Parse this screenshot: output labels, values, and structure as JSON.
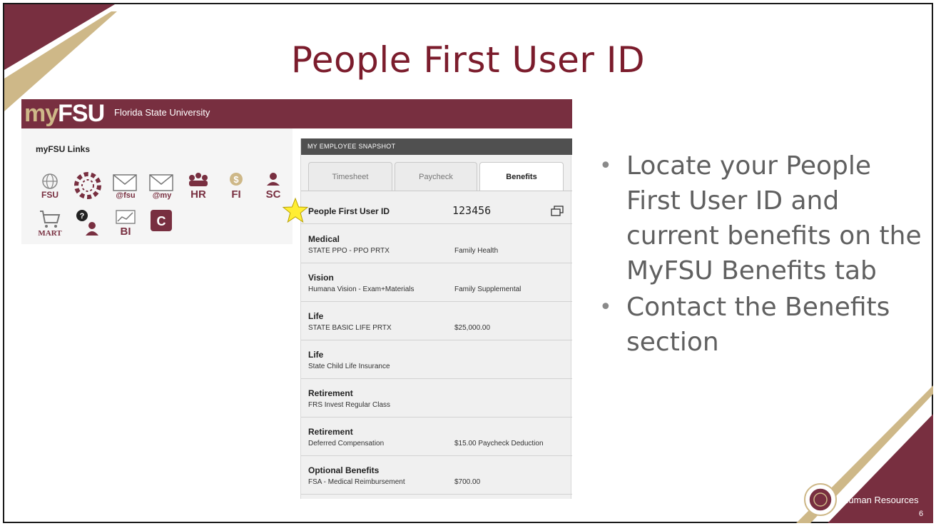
{
  "slide": {
    "title": "People First User ID",
    "page_number": "6",
    "footer_label": "Human Resources"
  },
  "colors": {
    "garnet": "#782f40",
    "gold": "#ceb888",
    "title": "#7b1c2c"
  },
  "myfsu": {
    "logo_my": "my",
    "logo_fsu": "FSU",
    "subtitle": "Florida State University",
    "links_title": "myFSU Links",
    "links": [
      {
        "icon": "globe-fsu-icon",
        "label": "FSU"
      },
      {
        "icon": "canvas-ring-icon",
        "label": ""
      },
      {
        "icon": "mail-fsu-icon",
        "label": "@fsu"
      },
      {
        "icon": "mail-my-icon",
        "label": "@my"
      },
      {
        "icon": "people-hr-icon",
        "label": "HR"
      },
      {
        "icon": "money-fi-icon",
        "label": "FI"
      },
      {
        "icon": "person-sc-icon",
        "label": "SC"
      },
      {
        "icon": "cart-mart-icon",
        "label": "MART"
      },
      {
        "icon": "help-person-icon",
        "label": ""
      },
      {
        "icon": "chart-bi-icon",
        "label": "BI"
      },
      {
        "icon": "c-logo-icon",
        "label": "C"
      }
    ]
  },
  "snapshot": {
    "header": "MY EMPLOYEE SNAPSHOT",
    "tabs": [
      "Timesheet",
      "Paycheck",
      "Benefits"
    ],
    "active_tab": "Benefits",
    "user_id_label": "People First User ID",
    "user_id_value": "123456",
    "benefits": [
      {
        "title": "Medical",
        "plan": "STATE PPO - PPO PRTX",
        "coverage": "Family Health"
      },
      {
        "title": "Vision",
        "plan": "Humana Vision - Exam+Materials",
        "coverage": "Family Supplemental"
      },
      {
        "title": "Life",
        "plan": "STATE BASIC LIFE PRTX",
        "coverage": "$25,000.00"
      },
      {
        "title": "Life",
        "plan": "State Child Life Insurance",
        "coverage": ""
      },
      {
        "title": "Retirement",
        "plan": "FRS Invest Regular Class",
        "coverage": ""
      },
      {
        "title": "Retirement",
        "plan": "Deferred Compensation",
        "coverage": "$15.00 Paycheck Deduction"
      },
      {
        "title": "Optional Benefits",
        "plan": "FSA - Medical Reimbursement",
        "coverage": "$700.00"
      }
    ]
  },
  "bullets": [
    "Locate your People First User ID and current benefits on the MyFSU Benefits tab",
    "Contact the Benefits section"
  ]
}
